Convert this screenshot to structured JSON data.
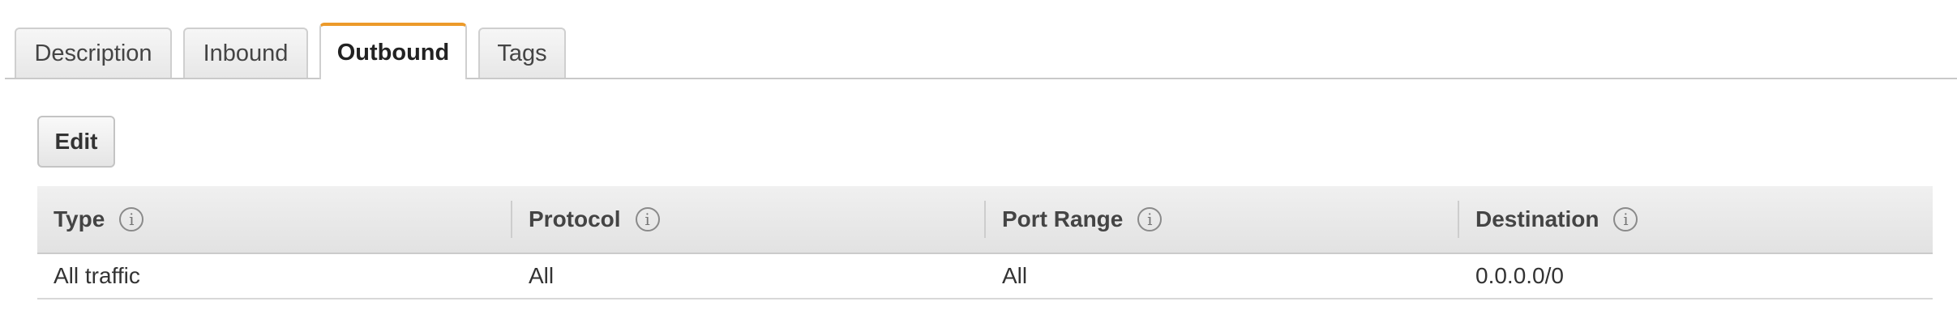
{
  "tabs": [
    {
      "label": "Description"
    },
    {
      "label": "Inbound"
    },
    {
      "label": "Outbound",
      "active": true
    },
    {
      "label": "Tags"
    }
  ],
  "toolbar": {
    "edit_label": "Edit"
  },
  "table": {
    "columns": [
      {
        "label": "Type",
        "info_icon": "i"
      },
      {
        "label": "Protocol",
        "info_icon": "i"
      },
      {
        "label": "Port Range",
        "info_icon": "i"
      },
      {
        "label": "Destination",
        "info_icon": "i"
      }
    ],
    "rows": [
      [
        "All traffic",
        "All",
        "All",
        "0.0.0.0/0"
      ]
    ]
  },
  "colors": {
    "active_tab_accent": "#ec9a2a",
    "text": "#444444",
    "border": "#c9c9c9"
  }
}
